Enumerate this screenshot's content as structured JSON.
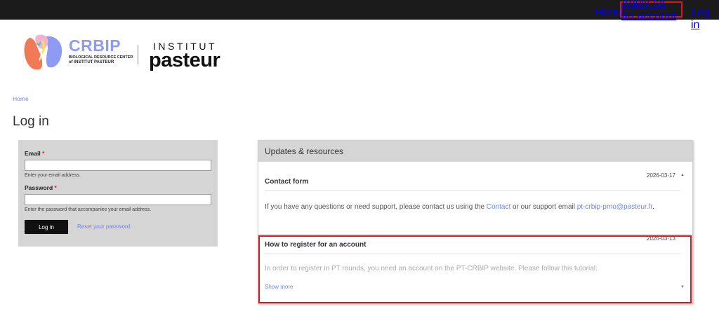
{
  "topnav": {
    "home": "Home",
    "apply": "Apply for an account",
    "login": "Log in"
  },
  "logo": {
    "crbip": "CRBIP",
    "crbip_sub1": "BIOLOGICAL RESOURCE CENTER",
    "crbip_sub2": "of INSTITUT PASTEUR",
    "institut": "INSTITUT",
    "pasteur": "pasteur"
  },
  "breadcrumb": "Home",
  "page_title": "Log in",
  "login_form": {
    "email_label": "Email",
    "email_value": "",
    "email_help": "Enter your email address.",
    "password_label": "Password",
    "password_value": "",
    "password_help": "Enter the password that accompanies your email address.",
    "required_mark": "*",
    "submit": "Log in",
    "reset": "Reset your password"
  },
  "updates": {
    "title": "Updates & resources",
    "items": [
      {
        "date": "2026-03-17",
        "title": "Contact form",
        "body_pre": "If you have any questions or need support, please contact us using the ",
        "body_link1": "Contact",
        "body_mid": " or our support email ",
        "body_link2": "pt-crbip-pmo@pasteur.fr",
        "body_post": "."
      },
      {
        "date": "2026-03-13",
        "title": "How to register for an account",
        "body": "In order to register in PT rounds, you need an account on the PT-CRBIP website. Please follow this tutorial:",
        "show_more": "Show more"
      }
    ]
  },
  "colors": {
    "topbar": "#1b1b1b",
    "accent_link": "#6e86e8",
    "highlight": "#e1141e",
    "crbip_brand": "#8e9bf2",
    "panel_gray": "#d5d5d5"
  }
}
